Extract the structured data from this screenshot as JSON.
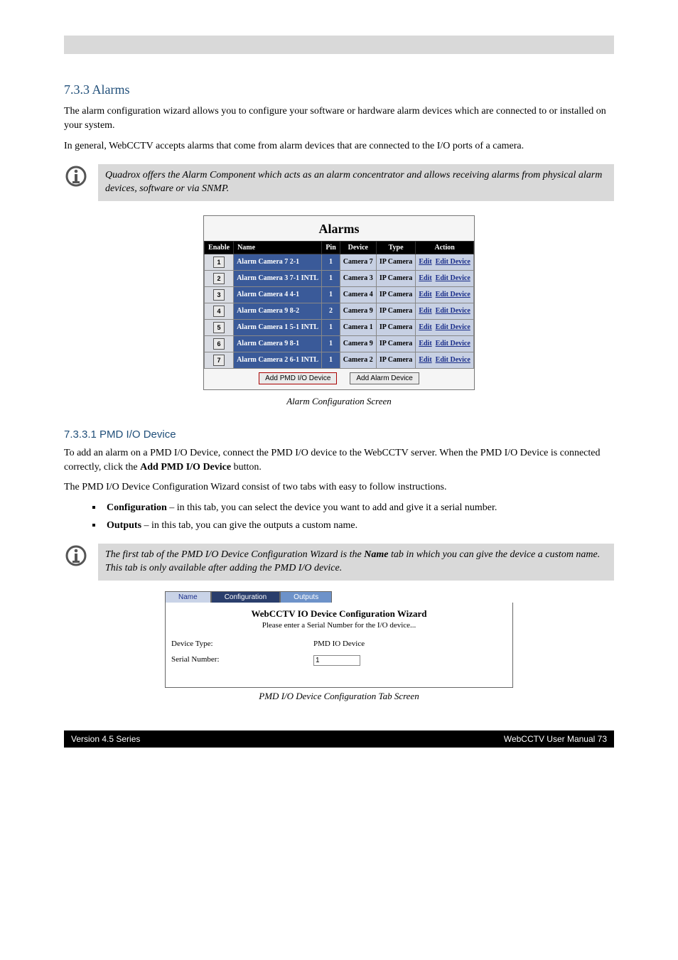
{
  "section_heading": "7.3.3 Alarms",
  "intro1": "The alarm configuration wizard allows you to configure your software or hardware alarm devices which are connected to or installed on your system.",
  "intro2": "In general, WebCCTV accepts alarms that come from alarm devices that are connected to the I/O ports of a camera.",
  "note1": "Quadrox offers the Alarm Component which acts as an alarm concentrator and allows receiving alarms from physical alarm devices, software or via SNMP.",
  "alarms": {
    "title": "Alarms",
    "columns": [
      "Enable",
      "Name",
      "Pin",
      "Device",
      "Type",
      "Action"
    ],
    "rows": [
      {
        "enable": "1",
        "name": "Alarm Camera 7 2-1",
        "pin": "1",
        "device": "Camera 7",
        "type": "IP Camera",
        "edit": "Edit",
        "editdev": "Edit Device"
      },
      {
        "enable": "2",
        "name": "Alarm Camera 3 7-1 INTL",
        "pin": "1",
        "device": "Camera 3",
        "type": "IP Camera",
        "edit": "Edit",
        "editdev": "Edit Device"
      },
      {
        "enable": "3",
        "name": "Alarm Camera 4 4-1",
        "pin": "1",
        "device": "Camera 4",
        "type": "IP Camera",
        "edit": "Edit",
        "editdev": "Edit Device"
      },
      {
        "enable": "4",
        "name": "Alarm Camera 9 8-2",
        "pin": "2",
        "device": "Camera 9",
        "type": "IP Camera",
        "edit": "Edit",
        "editdev": "Edit Device"
      },
      {
        "enable": "5",
        "name": "Alarm Camera 1 5-1 INTL",
        "pin": "1",
        "device": "Camera 1",
        "type": "IP Camera",
        "edit": "Edit",
        "editdev": "Edit Device"
      },
      {
        "enable": "6",
        "name": "Alarm Camera 9 8-1",
        "pin": "1",
        "device": "Camera 9",
        "type": "IP Camera",
        "edit": "Edit",
        "editdev": "Edit Device"
      },
      {
        "enable": "7",
        "name": "Alarm Camera 2 6-1 INTL",
        "pin": "1",
        "device": "Camera 2",
        "type": "IP Camera",
        "edit": "Edit",
        "editdev": "Edit Device"
      }
    ],
    "btn_add_pmd": "Add PMD I/O Device",
    "btn_add_alarm": "Add Alarm Device",
    "caption": "Alarm Configuration Screen"
  },
  "pmd": {
    "heading": "7.3.3.1 PMD I/O Device",
    "p1": "To add an alarm on a PMD I/O Device, connect the PMD I/O device to the WebCCTV server. When the PMD I/O Device is connected correctly, click the Add PMD I/O Device button.",
    "p2": "The PMD I/O Device Configuration Wizard consist of two tabs with easy to follow instructions.",
    "bullets": [
      "Configuration – in this tab, you can select the device you want to add and give it a serial number.",
      "Outputs – in this tab, you can give the outputs a custom name."
    ],
    "note2": "The first tab of the PMD I/O Device Configuration Wizard is the Name tab in which you can give the device a custom name. This tab is only available after adding the PMD I/O device."
  },
  "wizard": {
    "tabs": {
      "name": "Name",
      "conf": "Configuration",
      "out": "Outputs"
    },
    "title": "WebCCTV IO Device Configuration Wizard",
    "sub": "Please enter a Serial Number for the I/O device...",
    "dev_type_lbl": "Device Type:",
    "dev_type_val": "PMD IO Device",
    "serial_lbl": "Serial Number:",
    "serial_val": "1",
    "caption": "PMD I/O Device Configuration Tab Screen"
  },
  "footer": {
    "left": "Version 4.5 Series",
    "right": "WebCCTV User Manual 73"
  }
}
